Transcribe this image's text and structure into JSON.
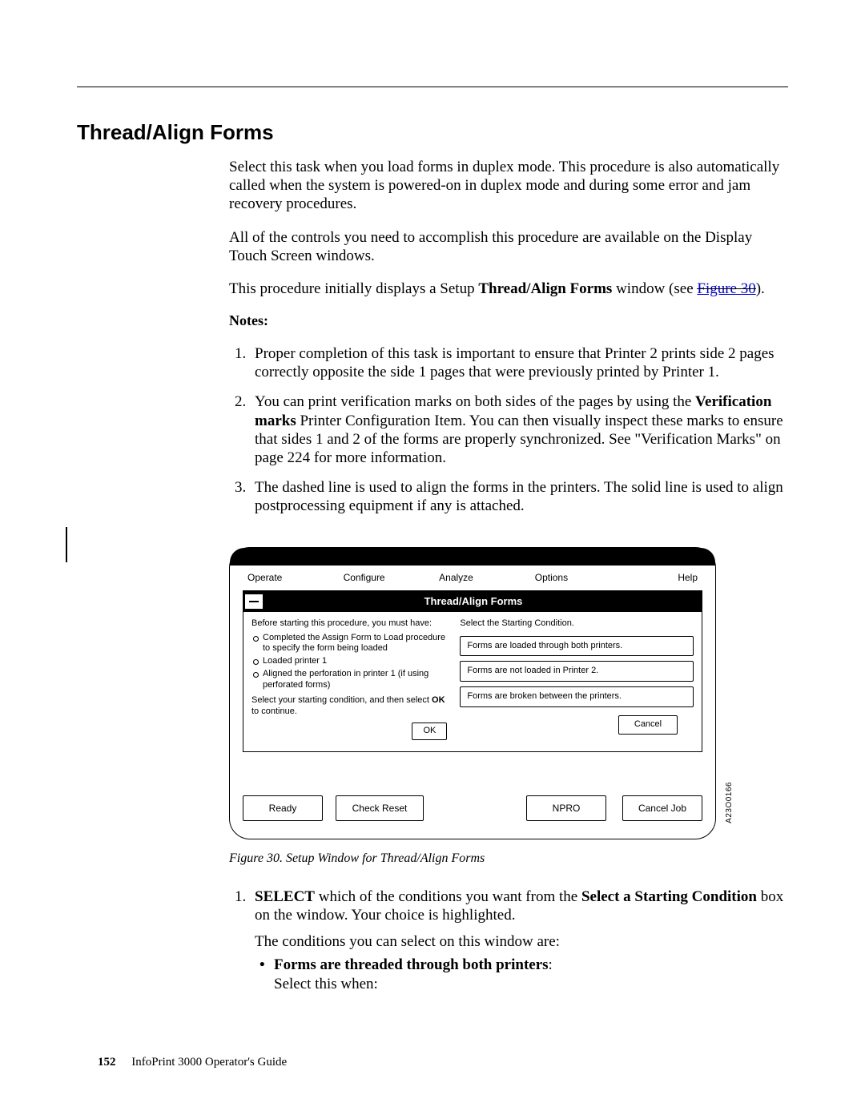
{
  "heading": "Thread/Align Forms",
  "p1": "Select this task when you load forms in duplex mode. This procedure is also automatically called when the system is powered-on in duplex mode and during some error and jam recovery procedures.",
  "p2": "All of the controls you need to accomplish this procedure are available on the Display Touch Screen windows.",
  "p3a": "This procedure initially displays a Setup ",
  "p3b_bold": "Thread/Align Forms",
  "p3c": " window (see ",
  "p3link": "Figure 30",
  "p3d": ").",
  "notes_label": "Notes:",
  "notes": {
    "n1": "Proper completion of this task is important to ensure that Printer 2 prints side 2 pages correctly opposite the side 1 pages that were previously printed by Printer 1.",
    "n2a": "You can print verification marks on both sides of the pages by using the ",
    "n2b_bold": "Verification marks",
    "n2c": " Printer Configuration Item. You can then visually inspect these marks to ensure that sides 1 and 2 of the forms are properly synchronized. See \"Verification Marks\" on page 224 for more information.",
    "n3": "The dashed line is used to align the forms in the printers. The solid line is used to align postprocessing equipment if any is attached."
  },
  "figure": {
    "menu": {
      "m1": "Operate",
      "m2": "Configure",
      "m3": "Analyze",
      "m4": "Options",
      "m5": "Help"
    },
    "title": "Thread/Align Forms",
    "left_intro": "Before starting this procedure, you must have:",
    "left_b1": "Completed the Assign Form to Load procedure to specify the form being loaded",
    "left_b2": "Loaded printer 1",
    "left_b3": "Aligned the perforation in printer 1 (if using perforated forms)",
    "left_out_a": "Select your starting condition, and then select ",
    "left_out_bold": "OK",
    "left_out_b": " to continue.",
    "ok": "OK",
    "right_lbl": "Select the Starting Condition.",
    "opt1": "Forms are loaded through both printers.",
    "opt2": "Forms are not loaded in Printer 2.",
    "opt3": "Forms are broken between the printers.",
    "cancel": "Cancel",
    "bottom": {
      "ready": "Ready",
      "check": "Check Reset",
      "npro": "NPRO",
      "canceljob": "Cancel Job"
    },
    "code": "A23O0166",
    "caption": "Figure 30. Setup Window for Thread/Align Forms"
  },
  "step1": {
    "a_bold": "SELECT",
    "b": " which of the conditions you want from the ",
    "c_bold": "Select a Starting Condition",
    "d": " box on the window. Your choice is highlighted.",
    "line2": "The conditions you can select on this window are:",
    "bullet1": "Forms are threaded through both printers",
    "bullet1_suffix": ":",
    "bullet1_line2": "Select this when:"
  },
  "footer": {
    "page": "152",
    "book": "InfoPrint 3000 Operator's Guide"
  }
}
